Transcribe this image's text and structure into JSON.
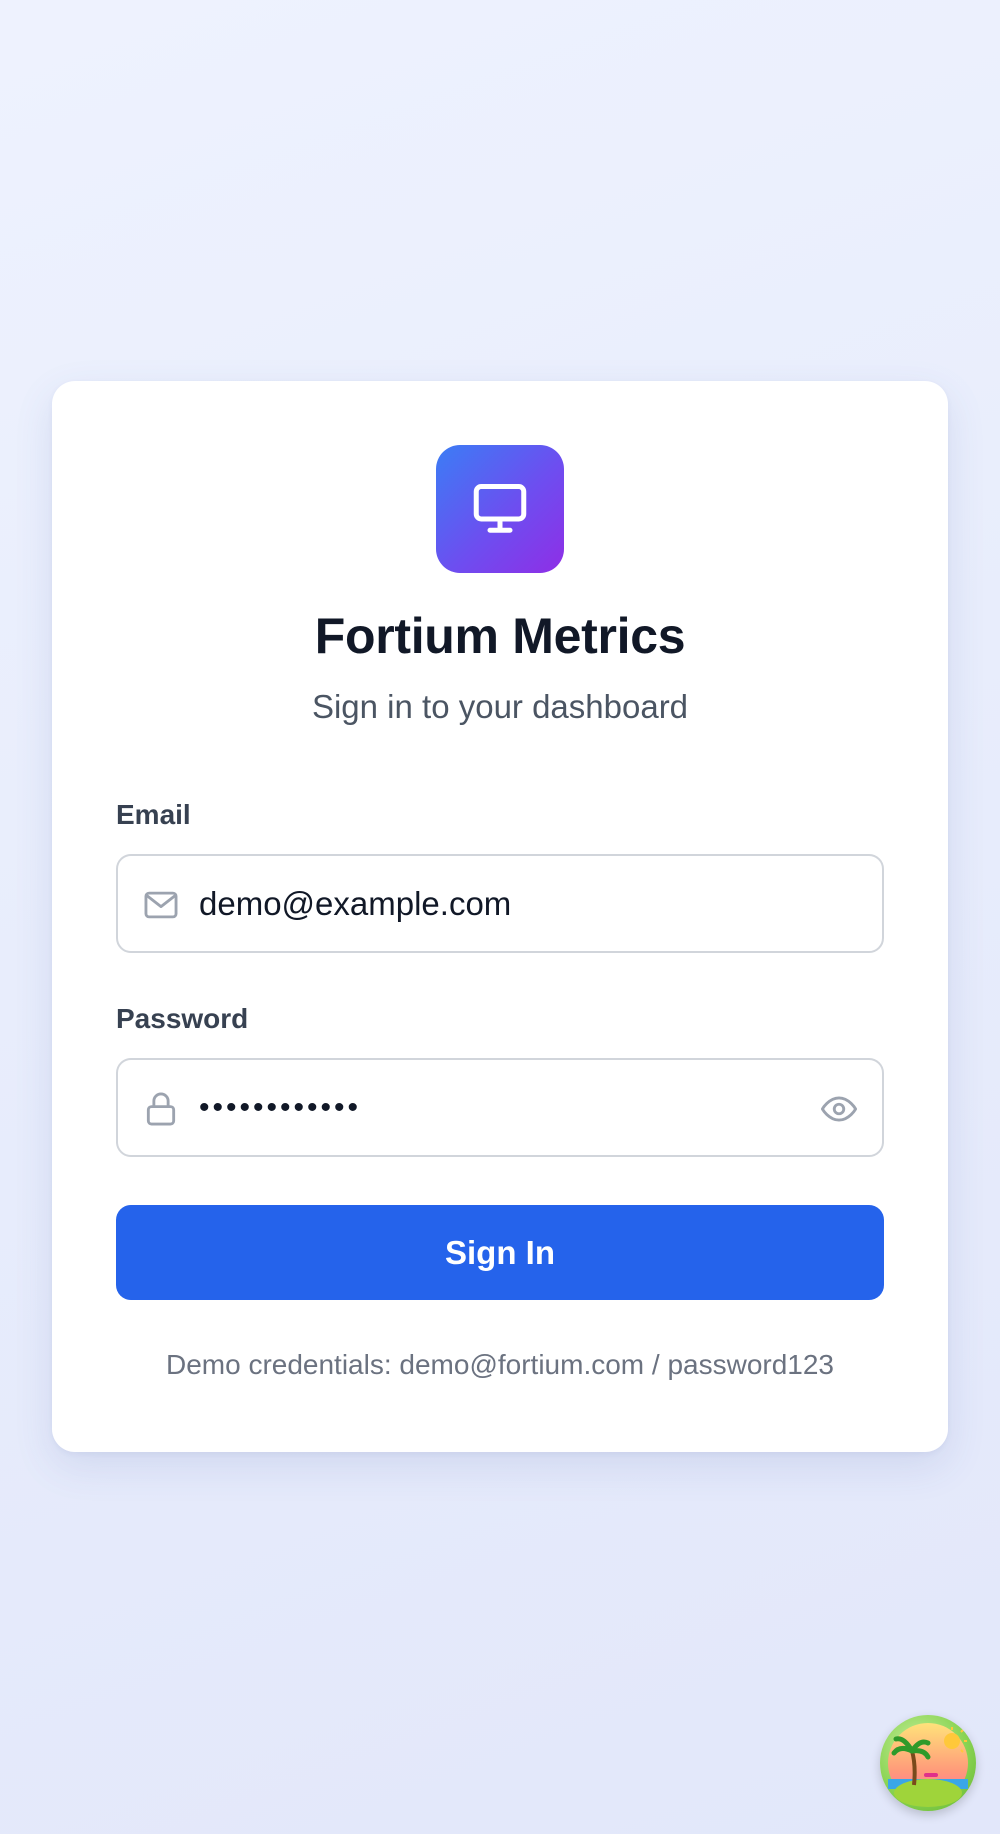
{
  "app": {
    "title": "Fortium Metrics",
    "subtitle": "Sign in to your dashboard",
    "logo_icon": "monitor-icon"
  },
  "form": {
    "email_label": "Email",
    "email_value": "demo@example.com",
    "email_icon": "mail-icon",
    "password_label": "Password",
    "password_value": "••••••••••••",
    "password_icon": "lock-icon",
    "password_toggle_icon": "eye-icon",
    "submit_label": "Sign In"
  },
  "hint": {
    "demo_credentials": "Demo credentials: demo@fortium.com / password123"
  },
  "floating_button": {
    "icon": "beach-island-icon"
  },
  "colors": {
    "primary": "#2563eb",
    "logo_gradient_start": "#3b7df5",
    "logo_gradient_end": "#8f2ee6",
    "background": "#e8edfc"
  }
}
